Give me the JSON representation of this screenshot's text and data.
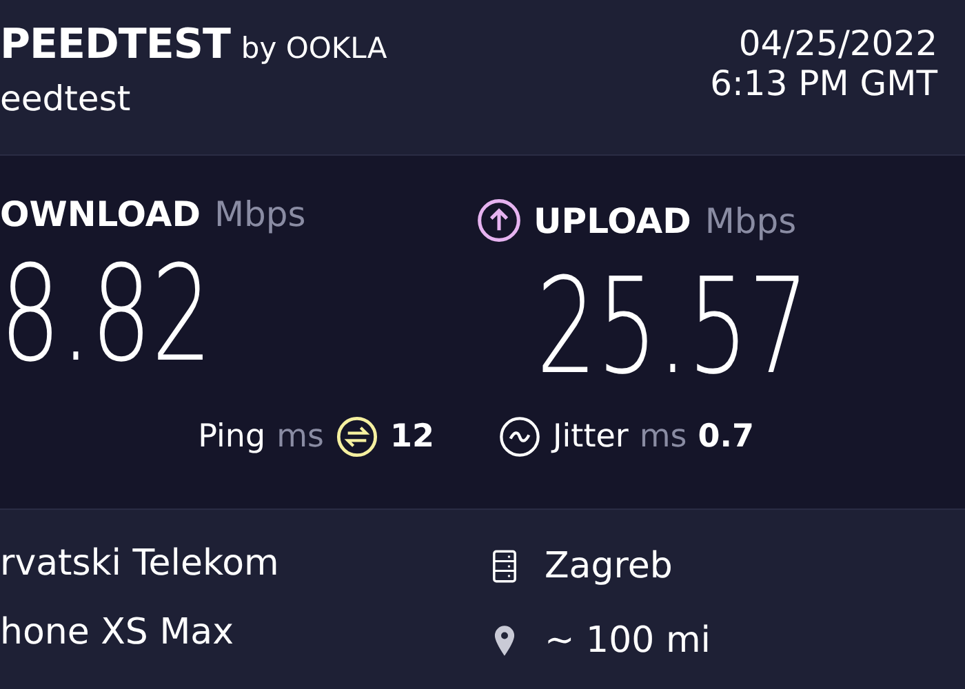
{
  "header": {
    "brand": "PEEDTEST",
    "brand_suffix": "by OOKLA",
    "subtitle": "eedtest",
    "date": "04/25/2022",
    "time": "6:13 PM GMT"
  },
  "results": [
    {
      "kind": "download",
      "label": "OWNLOAD",
      "unit": "Mbps",
      "value": "8.82"
    },
    {
      "kind": "upload",
      "label": "UPLOAD",
      "unit": "Mbps",
      "value": "25.57"
    }
  ],
  "latency": [
    {
      "kind": "ping",
      "label": "Ping",
      "unit": "ms",
      "value": "12"
    },
    {
      "kind": "jitter",
      "label": "Jitter",
      "unit": "ms",
      "value": "0.7"
    }
  ],
  "details": {
    "left": [
      "rvatski Telekom",
      "hone XS Max"
    ],
    "right": [
      {
        "kind": "server",
        "text": "Zagreb"
      },
      {
        "kind": "distance",
        "text": "~ 100 mi"
      }
    ]
  }
}
